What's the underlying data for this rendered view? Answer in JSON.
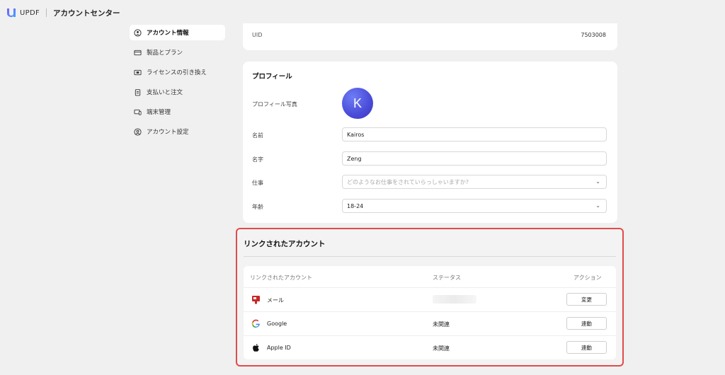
{
  "header": {
    "brand": "UPDF",
    "title": "アカウントセンター"
  },
  "sidebar": {
    "items": [
      {
        "label": "アカウント情報",
        "icon": "user-circle-icon",
        "active": true
      },
      {
        "label": "製品とプラン",
        "icon": "card-icon"
      },
      {
        "label": "ライセンスの引き換え",
        "icon": "ticket-icon"
      },
      {
        "label": "支払いと注文",
        "icon": "clipboard-icon"
      },
      {
        "label": "端末管理",
        "icon": "devices-icon"
      },
      {
        "label": "アカウント設定",
        "icon": "user-settings-icon"
      }
    ]
  },
  "uid": {
    "label": "UID",
    "value": "7503008"
  },
  "profile": {
    "title": "プロフィール",
    "photo_label": "プロフィール写真",
    "avatar_letter": "K",
    "first_name_label": "名前",
    "first_name_value": "Kairos",
    "last_name_label": "名字",
    "last_name_value": "Zeng",
    "job_label": "仕事",
    "job_placeholder": "どのようなお仕事をされていらっしゃいますか?",
    "age_label": "年齢",
    "age_value": "18-24"
  },
  "linked": {
    "title": "リンクされたアカウント",
    "headers": {
      "account": "リンクされたアカウント",
      "status": "ステータス",
      "action": "アクション"
    },
    "rows": [
      {
        "name": "メール",
        "icon": "mail-icon",
        "status": "",
        "action": "変更"
      },
      {
        "name": "Google",
        "icon": "google-icon",
        "status": "未関連",
        "action": "連動"
      },
      {
        "name": "Apple ID",
        "icon": "apple-icon",
        "status": "未関連",
        "action": "連動"
      }
    ]
  },
  "colors": {
    "highlight": "#e24b4b",
    "avatar": "#4a4bd8",
    "mail": "#c62828"
  }
}
